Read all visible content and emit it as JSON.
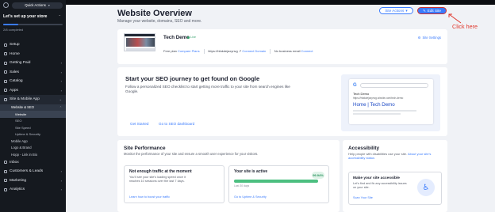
{
  "sidebar": {
    "quick_actions": "Quick Actions",
    "setup_title": "Let's set up your store",
    "setup_count": "2/8 completed",
    "setup_progress": 0.25,
    "items": [
      {
        "label": "Setup"
      },
      {
        "label": "Home"
      },
      {
        "label": "Getting Paid"
      },
      {
        "label": "Sales"
      },
      {
        "label": "Catalog"
      },
      {
        "label": "Apps"
      }
    ],
    "site_mobile": "Site & Mobile App",
    "website_seo": "Website & SEO",
    "sub_website": "Website",
    "sub_seo": "SEO",
    "sub_speed": "Site Speed",
    "sub_uptime": "Uptime & Security",
    "mobile_app": "Mobile App",
    "logo_brand": "Logo & Brand",
    "hopp": "Hopp - Link in Bio",
    "items_bottom": [
      {
        "label": "Inbox"
      },
      {
        "label": "Customers & Leads"
      },
      {
        "label": "Marketing"
      },
      {
        "label": "Analytics"
      }
    ]
  },
  "header": {
    "title": "Website Overview",
    "subtitle": "Manage your website, domains, SEO and more.",
    "site_actions": "Site Actions",
    "edit_site": "Edit Site",
    "annotation": "Click here"
  },
  "site_card": {
    "name": "Tech Demo",
    "status": "Live",
    "settings": "Site Settings",
    "plan": "Free plan",
    "compare": "Compare Plans",
    "url": "https://hfakdejaxynvg",
    "connect_domain": "Connect Domain",
    "no_email": "No business email",
    "connect_email": "Connect"
  },
  "seo_card": {
    "title": "Start your SEO journey to get found on Google",
    "desc": "Follow a personalized SEO checklist to start getting more traffic to your site from search engines like Google.",
    "get_started": "Get Started",
    "dashboard": "Go to SEO dashboard",
    "mock_name": "Tech Demo",
    "mock_url": "https://hfakdejaxynvg.wixsite.com/tech-demo",
    "mock_link": "Home | Tech Demo"
  },
  "performance": {
    "title": "Site Performance",
    "desc": "Monitor the performance of your site and ensure a smooth user experience for your visitors.",
    "box1_title": "Not enough traffic at the moment",
    "box1_text": "You'll see your site's loading speed once it reaches 10 sessions over the last 7 days.",
    "box1_link": "Learn how to boost your traffic",
    "box2_title": "Your site is active",
    "box2_score": "99.94%",
    "box2_score_value": 0.9994,
    "box2_sub": "Last 30 days",
    "box2_link": "Go to Uptime & Security"
  },
  "accessibility": {
    "title": "Accessibility",
    "desc": "Help people with disabilities use your site.",
    "link": "About your site's accessibility status",
    "box_title": "Make your site accessible",
    "box_text": "Let's find and fix any accessibility issues on your site.",
    "scan": "Scan Your Site"
  }
}
